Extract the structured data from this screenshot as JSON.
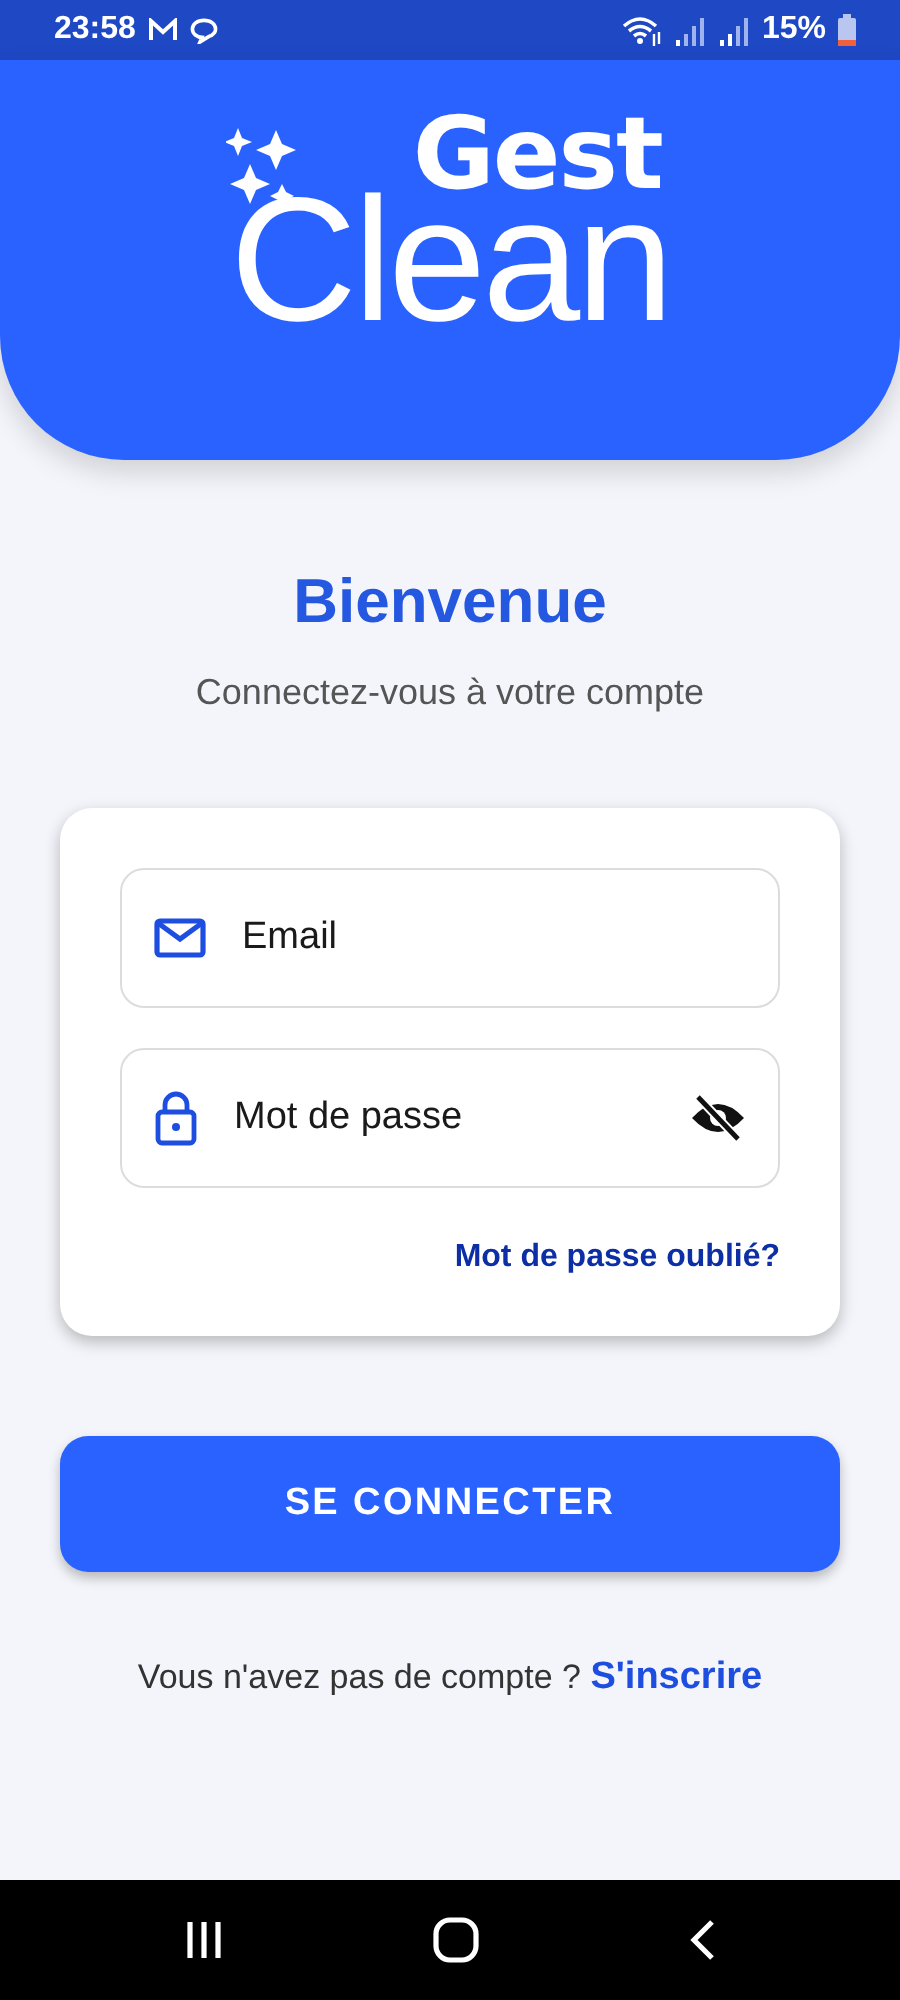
{
  "status_bar": {
    "time": "23:58",
    "battery": "15%"
  },
  "logo": {
    "top": "Gest",
    "main": "Clean"
  },
  "title": "Bienvenue",
  "subtitle": "Connectez-vous à votre compte",
  "fields": [
    {
      "kind": "email",
      "placeholder": "Email"
    },
    {
      "kind": "password",
      "placeholder": "Mot de passe",
      "password_visible": false
    }
  ],
  "forgot_link": "Mot de passe oublié?",
  "login_button": "SE CONNECTER",
  "signup": {
    "prompt": "Vous n'avez pas de compte ?",
    "link": "S'inscrire"
  }
}
